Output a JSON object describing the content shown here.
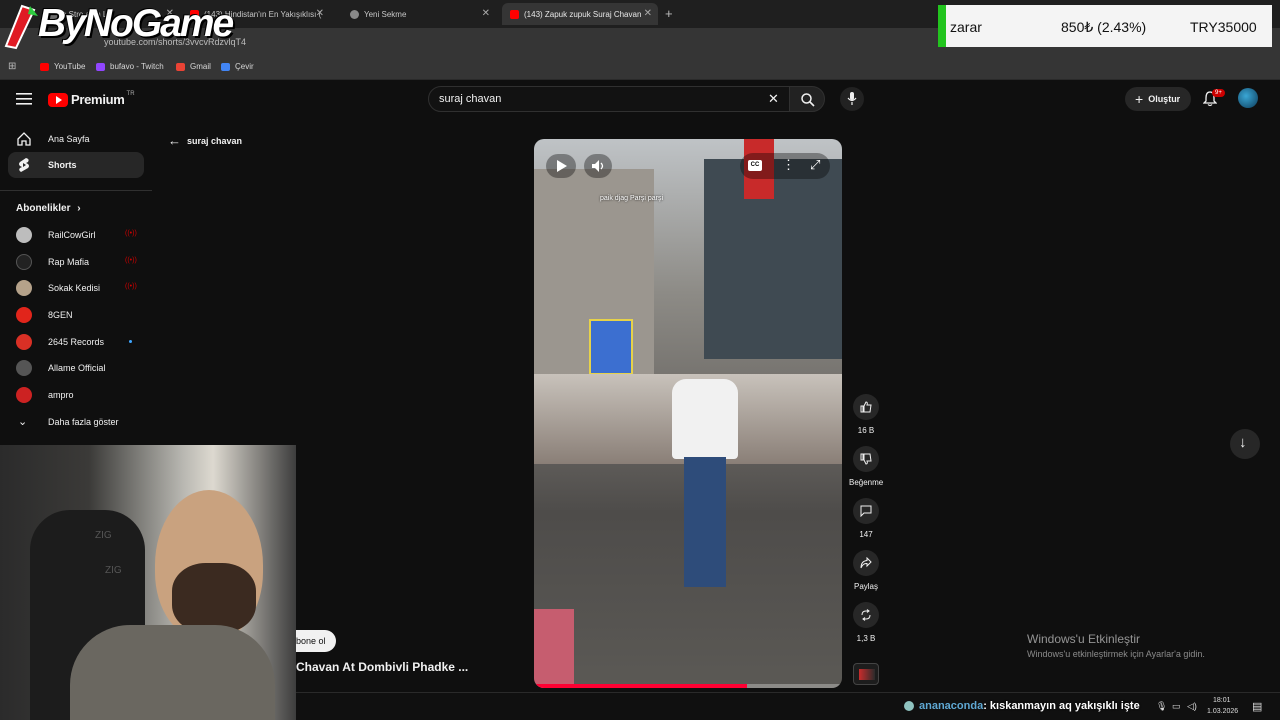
{
  "browser": {
    "tabs": [
      {
        "label": "o Stre   atch Liv",
        "color": "#6c6c6c"
      },
      {
        "label": "(143) Hindistan'ın En Yakışıklısı (",
        "color": "#ff0000"
      },
      {
        "label": "Yeni Sekme",
        "color": "#8a8a8a"
      },
      {
        "label": "(143) Zapuk zupuk Suraj Chavan",
        "color": "#ff0000"
      }
    ],
    "url": "youtube.com/shorts/3vvcvRdzvlqT4",
    "bookmarks": [
      {
        "label": "YouTube",
        "color": "#ff0000"
      },
      {
        "label": "bufavo - Twitch",
        "color": "#9146ff"
      },
      {
        "label": "Gmail",
        "color": "#ea4335"
      },
      {
        "label": "Çevir",
        "color": "#4285f4"
      }
    ]
  },
  "overlay": {
    "logo": "ByNoGame",
    "ticker": {
      "label": "zarar",
      "change": "850₺ (2.43%)",
      "total": "TRY35000"
    }
  },
  "header": {
    "brand": "Premium",
    "region": "TR",
    "search_query": "suraj chavan",
    "create_label": "Oluştur",
    "notifications": "9+"
  },
  "sidebar": {
    "items": [
      {
        "label": "Ana Sayfa"
      },
      {
        "label": "Shorts"
      }
    ],
    "subscriptions_title": "Abonelikler",
    "subscriptions": [
      {
        "name": "RailCowGirl",
        "live": "((•))",
        "color": "#bdbdbd"
      },
      {
        "name": "Rap Mafia",
        "live": "((•))",
        "color": "#222222"
      },
      {
        "name": "Sokak Kedisi",
        "live": "((•))",
        "color": "#b5a28a"
      },
      {
        "name": "8GEN",
        "live": "",
        "color": "#e1251b"
      },
      {
        "name": "2645 Records",
        "live": "",
        "color": "#d93025"
      },
      {
        "name": "Allame Official",
        "live": "",
        "color": "#555555"
      },
      {
        "name": "ampro",
        "live": "",
        "color": "#cc2222"
      }
    ],
    "more_label": "Daha fazla göster"
  },
  "back_label": "suraj chavan",
  "short": {
    "caption": "paik djag Parşi parşi",
    "title": "Chavan At Dombivli Phadke ...",
    "subscribe_label": "bone ol",
    "progress": 0.69,
    "actions": {
      "likes": "16 B",
      "dislike": "Beğenme",
      "comments": "147",
      "share": "Paylaş",
      "remix": "1,3 B"
    }
  },
  "windows_activation": {
    "title": "Windows'u Etkinleştir",
    "subtitle": "Windows'u etkinleştirmek için Ayarlar'a gidin."
  },
  "chat": {
    "user": "ananaconda",
    "message": ": kıskanmayın aq yakışıklı işte"
  },
  "taskbar": {
    "time": "18:01",
    "date": "1.03.2026"
  }
}
